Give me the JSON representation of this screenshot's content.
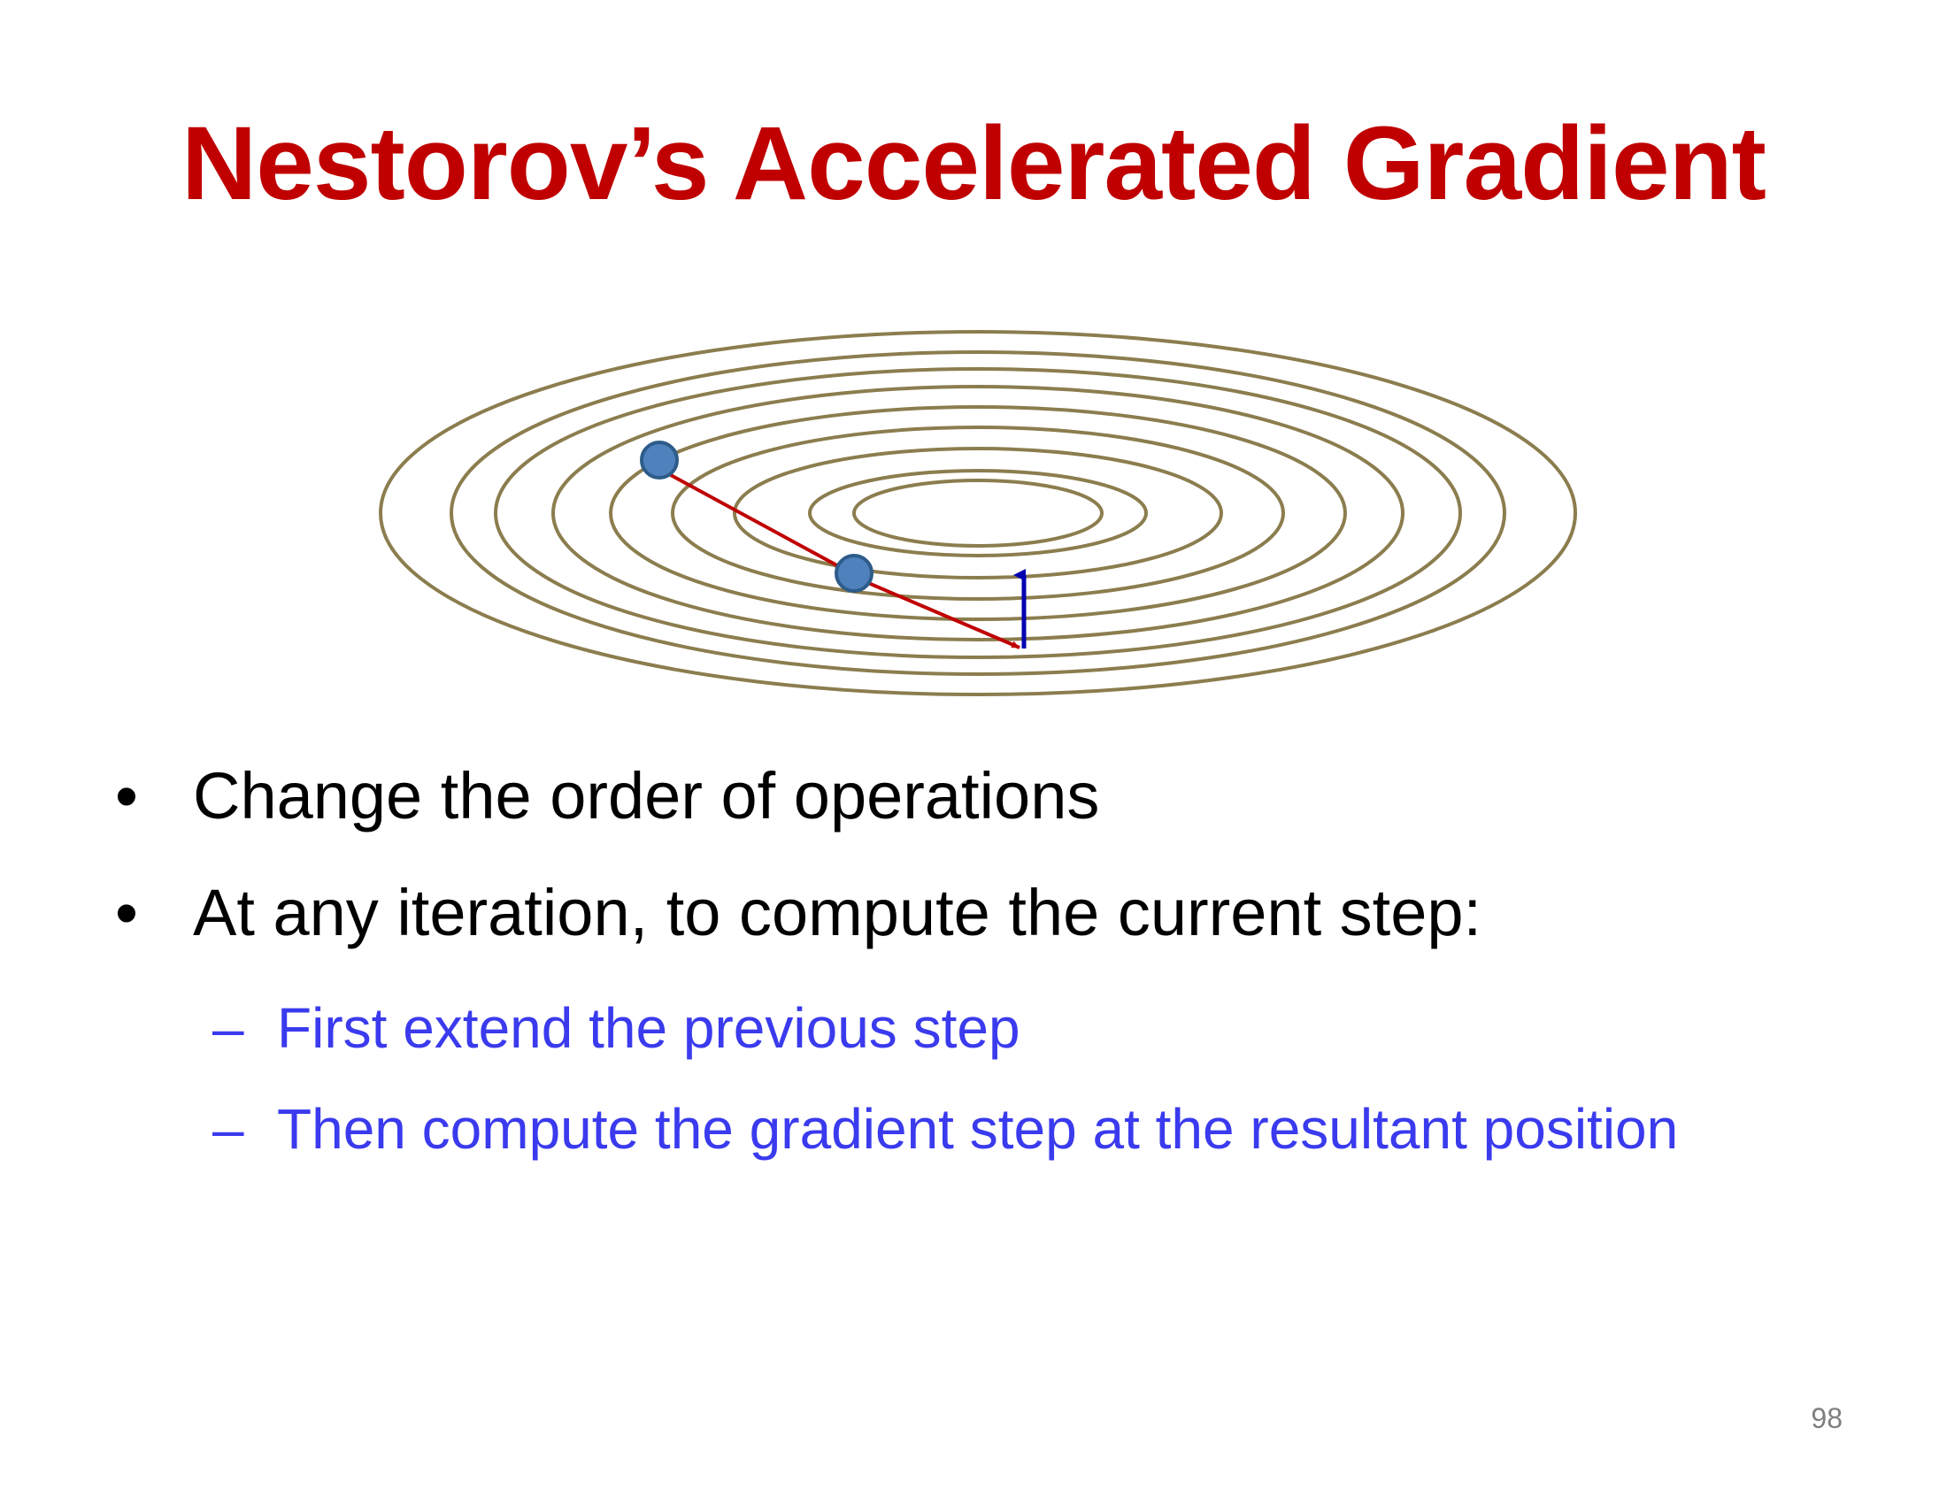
{
  "slide": {
    "title": "Nestorov’s Accelerated Gradient",
    "bullets": [
      "Change the order of operations",
      "At any iteration, to compute the current step:"
    ],
    "sub_bullets": [
      "First extend the previous step",
      "Then compute the gradient step at the resultant position"
    ],
    "bullet_marker": "•",
    "sub_bullet_marker": "–",
    "page_number": "98"
  },
  "diagram": {
    "contour_color": "#8b7d4e",
    "point_color": "#4f81bd",
    "step_arrow_color": "#c00000",
    "gradient_arrow_color": "#0000b0"
  }
}
